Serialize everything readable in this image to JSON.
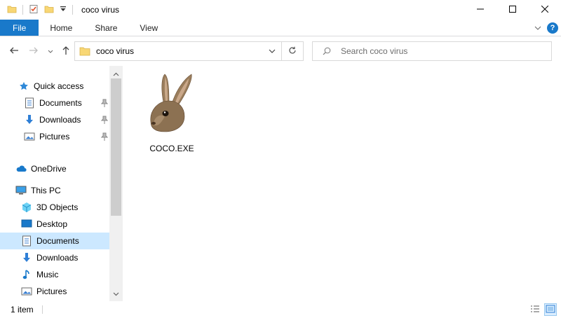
{
  "window": {
    "title": "coco virus",
    "controls": [
      "minimize-icon",
      "maximize-icon",
      "close-icon"
    ]
  },
  "ribbon": {
    "tabs": [
      "File",
      "Home",
      "Share",
      "View"
    ],
    "active_tab": "File",
    "accent": "#1979ca",
    "help_glyph": "?"
  },
  "address": {
    "path": "coco virus",
    "search_placeholder": "Search coco virus"
  },
  "nav": {
    "quick_access": {
      "label": "Quick access",
      "items": [
        {
          "label": "Documents",
          "icon": "document-icon",
          "pinned": true
        },
        {
          "label": "Downloads",
          "icon": "download-arrow-icon",
          "pinned": true
        },
        {
          "label": "Pictures",
          "icon": "pictures-icon",
          "pinned": true
        }
      ]
    },
    "onedrive": {
      "label": "OneDrive"
    },
    "this_pc": {
      "label": "This PC",
      "items": [
        {
          "label": "3D Objects",
          "icon": "cube-icon"
        },
        {
          "label": "Desktop",
          "icon": "desktop-icon"
        },
        {
          "label": "Documents",
          "icon": "document-icon",
          "selected": true
        },
        {
          "label": "Downloads",
          "icon": "download-arrow-icon"
        },
        {
          "label": "Music",
          "icon": "music-note-icon"
        },
        {
          "label": "Pictures",
          "icon": "pictures-icon"
        }
      ]
    },
    "selection_color": "#cce8ff"
  },
  "content": {
    "files": [
      {
        "name": "COCO.EXE",
        "icon": "rabbit-icon"
      }
    ]
  },
  "status": {
    "item_count": "1 item"
  }
}
